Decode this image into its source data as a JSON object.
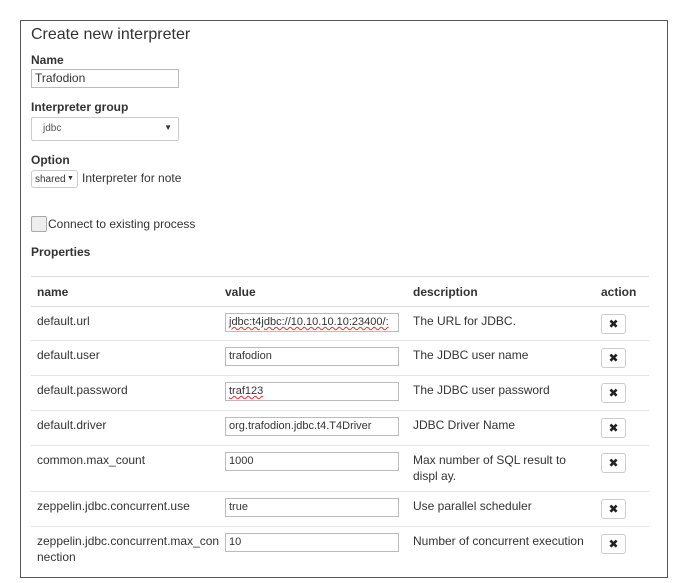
{
  "form": {
    "title": "Create new interpreter",
    "name_label": "Name",
    "name_value": "Trafodion",
    "group_label": "Interpreter group",
    "group_value": "jdbc",
    "option_label": "Option",
    "option_mode": "shared",
    "option_suffix": "Interpreter for note",
    "connect_label": "Connect to existing process",
    "connect_checked": false,
    "properties_label": "Properties"
  },
  "properties": {
    "columns": [
      "name",
      "value",
      "description",
      "action"
    ],
    "rows": [
      {
        "name": "default.url",
        "value": "jdbc:t4jdbc://10.10.10.10:23400/:",
        "description": "The URL for JDBC."
      },
      {
        "name": "default.user",
        "value": "trafodion",
        "description": "The JDBC user name"
      },
      {
        "name": "default.password",
        "value": "traf123",
        "description": "The JDBC user password"
      },
      {
        "name": "default.driver",
        "value": "org.trafodion.jdbc.t4.T4Driver",
        "description": "JDBC Driver Name"
      },
      {
        "name": "common.max_count",
        "value": "1000",
        "description": "Max number of SQL result to displ ay."
      },
      {
        "name": "zeppelin.jdbc.concurrent.use",
        "value": "true",
        "description": "Use parallel scheduler"
      },
      {
        "name": "zeppelin.jdbc.concurrent.max_con nection",
        "value": "10",
        "description": "Number of concurrent execution"
      }
    ],
    "delete_icon": "close-icon"
  }
}
